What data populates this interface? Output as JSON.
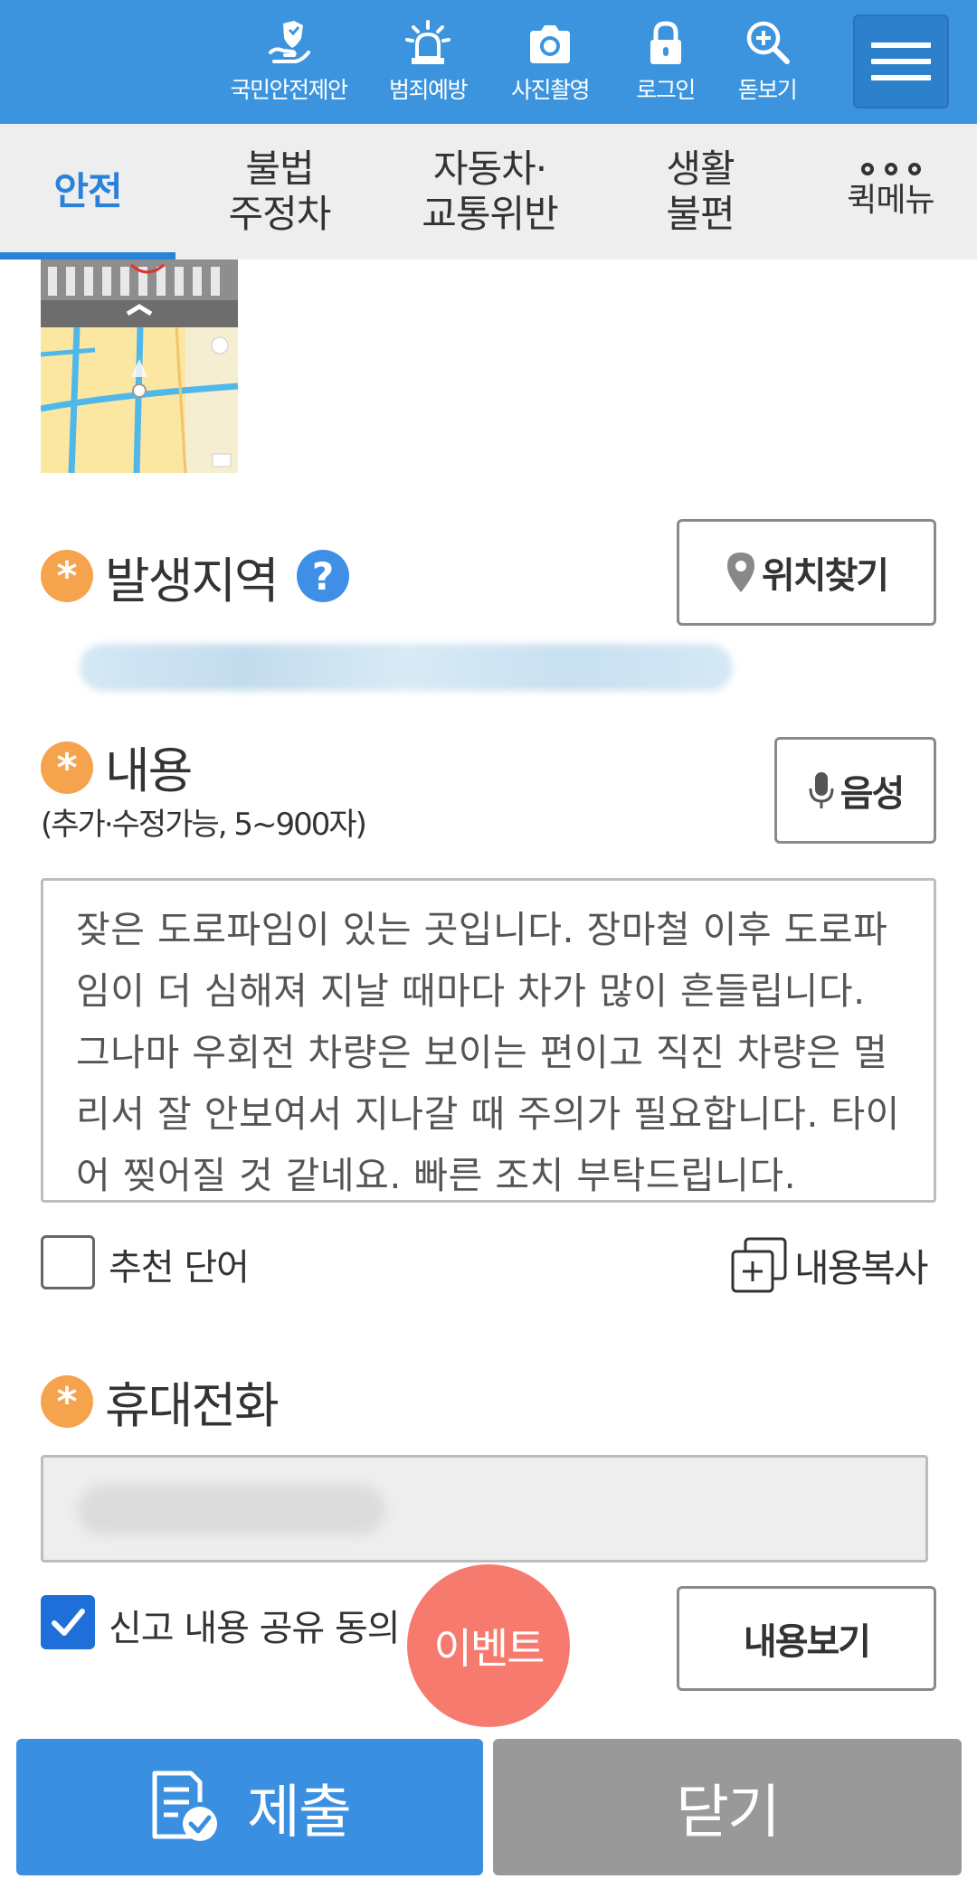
{
  "topbar": {
    "icons": [
      {
        "label": "국민안전제안",
        "icon": "hand-shield-icon"
      },
      {
        "label": "범죄예방",
        "icon": "siren-icon"
      },
      {
        "label": "사진촬영",
        "icon": "camera-icon"
      },
      {
        "label": "로그인",
        "icon": "lock-icon"
      },
      {
        "label": "돋보기",
        "icon": "magnifier-icon"
      }
    ],
    "menu_icon": "hamburger-menu-icon"
  },
  "tabs": [
    {
      "line1": "안전",
      "line2": "",
      "active": true
    },
    {
      "line1": "불법",
      "line2": "주정차",
      "active": false
    },
    {
      "line1": "자동차·",
      "line2": "교통위반",
      "active": false
    },
    {
      "line1": "생활",
      "line2": "불편",
      "active": false
    }
  ],
  "quick_menu": {
    "label": "퀵메뉴",
    "icon": "dots-icon"
  },
  "location": {
    "title": "발생지역",
    "help_icon": "?",
    "find_button": "위치찾기",
    "find_icon": "map-pin-icon"
  },
  "content": {
    "title": "내용",
    "note": "(추가·수정가능, 5~900자)",
    "voice_button": "음성",
    "voice_icon": "microphone-icon",
    "text": "잦은 도로파임이 있는 곳입니다. 장마철 이후 도로파임이 더 심해져 지날 때마다 차가 많이 흔들립니다. 그나마 우회전 차량은 보이는 편이고 직진 차량은 멀리서 잘 안보여서 지나갈 때 주의가 필요합니다. 타이어 찢어질 것 같네요. 빠른 조치 부탁드립니다.",
    "recommend_label": "추천 단어",
    "recommend_checked": false,
    "copy_label": "내용복사",
    "copy_icon": "copy-add-icon"
  },
  "phone": {
    "title": "휴대전화"
  },
  "share": {
    "label": "신고 내용 공유 동의",
    "checked": true,
    "view_button": "내용보기"
  },
  "event_button": "이벤트",
  "bottom": {
    "submit_label": "제출",
    "submit_icon": "document-check-icon",
    "close_label": "닫기"
  },
  "colors": {
    "primary": "#3c94de",
    "tab_active": "#2a82d8",
    "required": "#f6a34e",
    "event": "#f77a6f",
    "close_button": "#999999"
  }
}
